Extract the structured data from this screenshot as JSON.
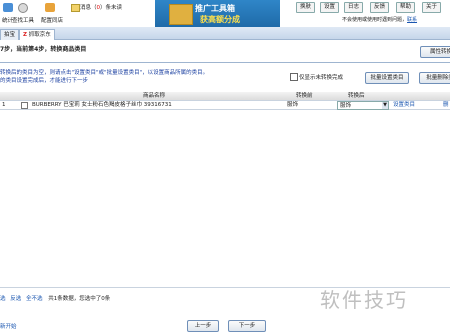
{
  "toolbar": {
    "items": [
      {
        "label": "统计",
        "icon": "chart-icon"
      },
      {
        "label": "查找工具",
        "icon": "search-icon"
      },
      {
        "label": "配置同店",
        "icon": "settings-icon"
      }
    ],
    "message_prefix": "消息（",
    "message_count": "0",
    "message_suffix": "）条未读",
    "banner": {
      "line1": "推广工具箱",
      "line2": "获高额分成"
    },
    "buttons": [
      "换肤",
      "设置",
      "日志",
      "反馈",
      "帮助",
      "关于"
    ],
    "notice_text": "不会使用或使用时遇到问题，",
    "notice_link": "联系"
  },
  "tabs": [
    {
      "label": "拍宝"
    },
    {
      "label": "抓取京东"
    }
  ],
  "step_text": "7步，当前第4步，转换商品类目",
  "attr_button": "属性转换",
  "tips": {
    "line1": "转换后的类目为空，则请点击\"设置类目\"或\"批量设置类目\"，以设置商品所属的类目。",
    "line2": "的类目设置完成后，才能进行下一步"
  },
  "only_unconverted_label": "仅显示未转换完成",
  "batch_set_button": "批量设置类目",
  "batch_delete_button": "批量删除类",
  "table": {
    "headers": {
      "name": "商品名称",
      "before": "转换前",
      "after": "转换后"
    },
    "rows": [
      {
        "index": "1",
        "name": "BURBERRY 巴宝莉 女士粉石色羯皮格子丝巾 39316731",
        "before": "服饰",
        "after": "服饰",
        "action": "设置类目",
        "extra": "删"
      }
    ]
  },
  "selection": {
    "invert": "反选",
    "select_all": "全不选",
    "summary": "共1条数据，您选中了0条"
  },
  "restart_link": "新开始",
  "nav": {
    "prev": "上一步",
    "next": "下一步"
  },
  "watermark": "软件技巧"
}
